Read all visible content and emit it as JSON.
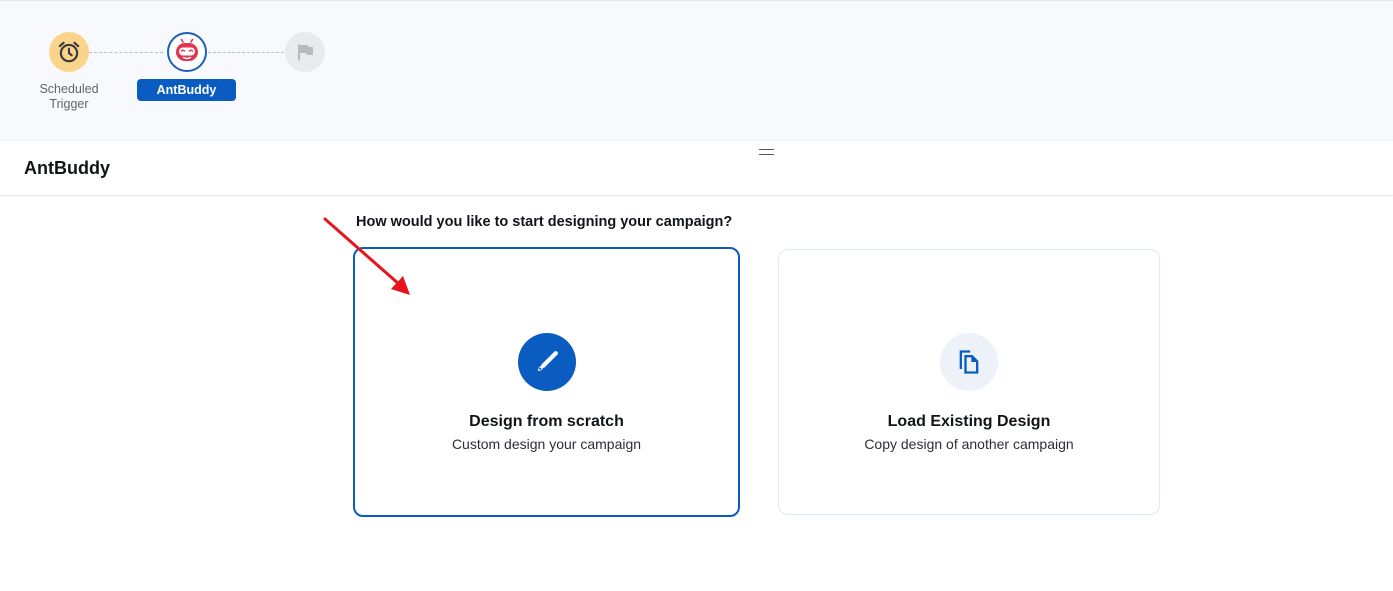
{
  "flow": {
    "nodes": [
      {
        "label": "Scheduled Trigger",
        "icon": "alarm-clock-icon"
      },
      {
        "label": "AntBuddy",
        "icon": "antbuddy-robot-icon",
        "selected": true
      },
      {
        "label": "",
        "icon": "flag-icon"
      }
    ]
  },
  "panel": {
    "title": "AntBuddy",
    "question": "How would you like to start designing your campaign?"
  },
  "options": [
    {
      "title": "Design from scratch",
      "subtitle": "Custom design your campaign",
      "icon": "paintbrush-icon",
      "selected": true
    },
    {
      "title": "Load Existing Design",
      "subtitle": "Copy design of another campaign",
      "icon": "copy-documents-icon",
      "selected": false
    }
  ],
  "colors": {
    "accent": "#0b5cc0",
    "trigger_node": "#fbd48c",
    "annotation_arrow": "#e8141b"
  }
}
